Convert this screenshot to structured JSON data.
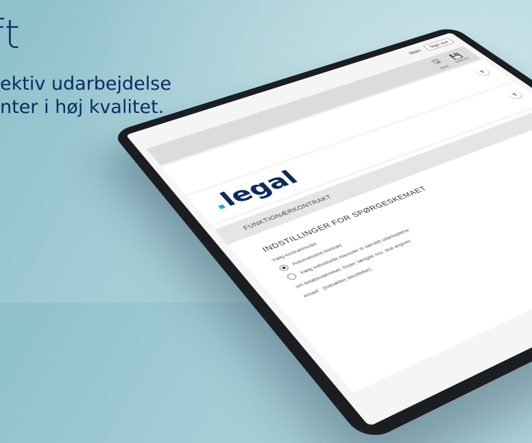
{
  "headline": {
    "big": "ft",
    "line1": "ektiv udarbejdelse",
    "line2": "nter i høj kvalitet."
  },
  "app": {
    "logo_dot": ".",
    "logo_text": "legal",
    "nav": {
      "main": "Main",
      "sign_out": "Sign out"
    },
    "toolbar": {
      "save": "SAVE",
      "save_as": "SAVE AS"
    },
    "help": "?",
    "section_title": "FUNKTIONÆRKONTRAKT",
    "settings_title": "INDSTILLINGER FOR SPØRGESKEMAET",
    "field_label": "Vælg kontraktmodel",
    "options": [
      {
        "label": "Automatiseret kontrakt",
        "selected": true
      },
      {
        "label": "Vælg individuelle klausuler til særskilt udarbejdelse",
        "selected": false
      },
      {
        "label": "om beløbsstørrelser, frister, længde osv. skal angives",
        "selected": false
      },
      {
        "label": "emaet",
        "suffix": "(indsættes tekstfelter)",
        "selected": false
      }
    ]
  },
  "colors": {
    "navy": "#0d2a5c",
    "accent_blue": "#29a3d6",
    "bg": "#a4cdd6"
  }
}
